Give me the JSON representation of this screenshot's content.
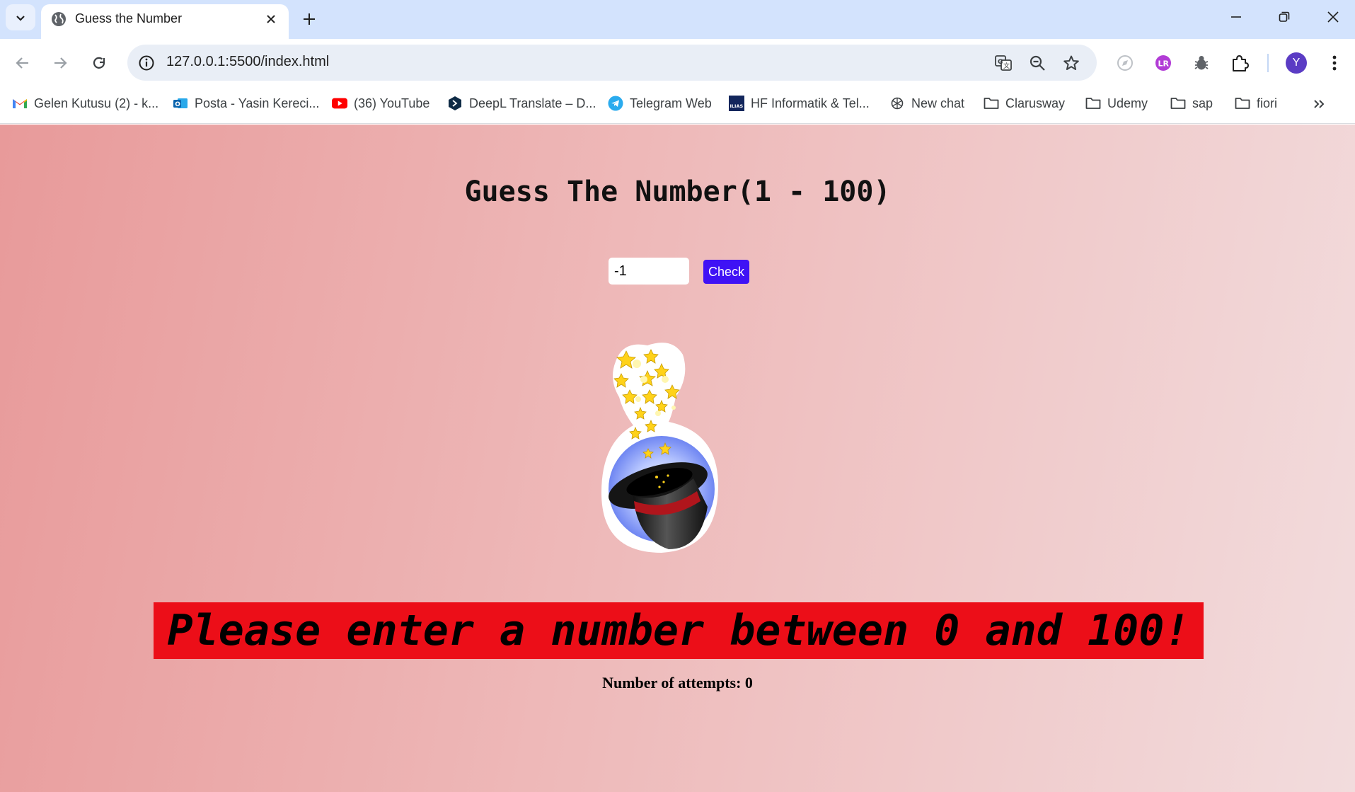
{
  "browser": {
    "tab": {
      "title": "Guess the Number"
    },
    "address": {
      "url": "127.0.0.1:5500/index.html"
    },
    "profile_initial": "Y",
    "bookmarks": [
      {
        "label": "Gelen Kutusu (2) - k...",
        "icon": "gmail-icon"
      },
      {
        "label": "Posta - Yasin Kereci...",
        "icon": "outlook-icon"
      },
      {
        "label": "(36) YouTube",
        "icon": "youtube-icon"
      },
      {
        "label": "DeepL Translate – D...",
        "icon": "deepl-icon"
      },
      {
        "label": "Telegram Web",
        "icon": "telegram-icon"
      },
      {
        "label": "HF Informatik & Tel...",
        "icon": "ilias-icon"
      },
      {
        "label": "New chat",
        "icon": "chatgpt-icon"
      },
      {
        "label": "Clarusway",
        "icon": "folder-icon"
      },
      {
        "label": "Udemy",
        "icon": "folder-icon"
      },
      {
        "label": "sap",
        "icon": "folder-icon"
      },
      {
        "label": "fiori",
        "icon": "folder-icon"
      }
    ],
    "accent_color": "#d3e3fd"
  },
  "game": {
    "title": "Guess The Number(1 - 100)",
    "input_value": "-1",
    "check_label": "Check",
    "message": "Please enter a number between 0 and 100!",
    "attempts_label": "Number of attempts:",
    "attempts_value": "0",
    "colors": {
      "message_bg": "#ec0e18",
      "button_bg": "#3f12f5"
    }
  }
}
